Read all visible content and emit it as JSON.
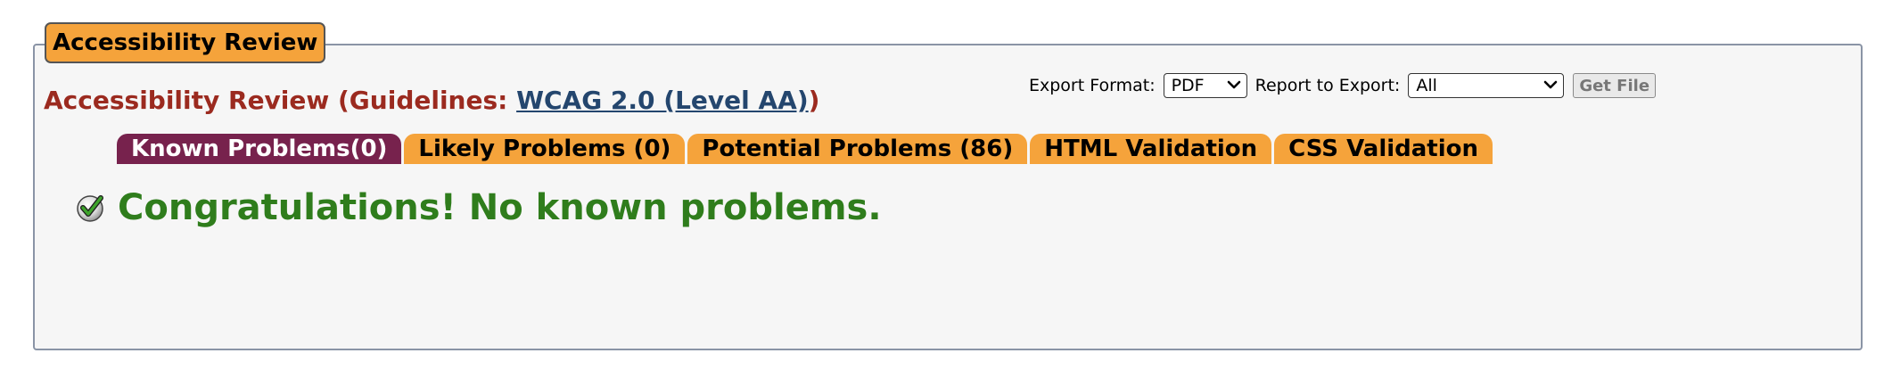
{
  "panel": {
    "legend": "Accessibility Review"
  },
  "heading": {
    "prefix": "Accessibility Review (Guidelines: ",
    "link": "WCAG 2.0 (Level AA)",
    "suffix": ")"
  },
  "export": {
    "format_label": "Export Format:",
    "format_value": "PDF",
    "report_label": "Report to Export:",
    "report_value": "All",
    "button_label": "Get File"
  },
  "tabs": [
    {
      "label": "Known Problems(0)",
      "active": true
    },
    {
      "label": "Likely Problems (0)",
      "active": false
    },
    {
      "label": "Potential Problems (86)",
      "active": false
    },
    {
      "label": "HTML Validation",
      "active": false
    },
    {
      "label": "CSS Validation",
      "active": false
    }
  ],
  "result": {
    "icon": "check-circle-icon",
    "message": "Congratulations! No known problems."
  },
  "colors": {
    "legend_bg": "#f5a33b",
    "tab_bg": "#f5a33b",
    "tab_active_bg": "#77224d",
    "heading_red": "#9b2a1f",
    "link_blue": "#24466e",
    "success_green": "#2f7d1c"
  }
}
